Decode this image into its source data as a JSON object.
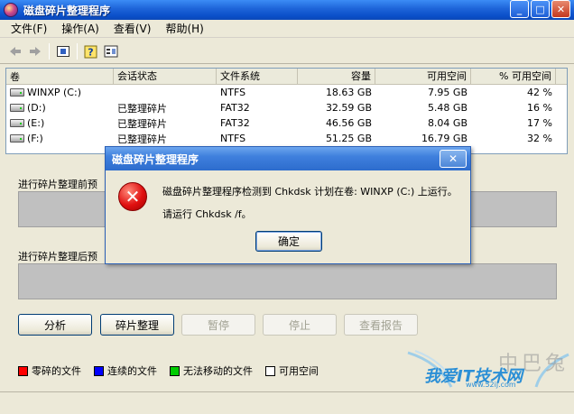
{
  "window": {
    "title": "磁盘碎片整理程序",
    "minimize_glyph": "_",
    "maximize_glyph": "□",
    "close_glyph": "✕"
  },
  "menu": [
    "文件(F)",
    "操作(A)",
    "查看(V)",
    "帮助(H)"
  ],
  "toolbar": {
    "back_icon": "left-arrow-icon",
    "forward_icon": "right-arrow-icon",
    "properties_icon": "properties-icon",
    "help_icon": "help-icon",
    "console_icon": "console-tree-icon"
  },
  "volumes": {
    "columns": [
      "卷",
      "会话状态",
      "文件系统",
      "容量",
      "可用空间",
      "% 可用空间"
    ],
    "rows": [
      {
        "volume": "WINXP (C:)",
        "status": "",
        "fs": "NTFS",
        "capacity": "18.63 GB",
        "free": "7.95 GB",
        "pct": "42 %"
      },
      {
        "volume": "(D:)",
        "status": "已整理碎片",
        "fs": "FAT32",
        "capacity": "32.59 GB",
        "free": "5.48 GB",
        "pct": "16 %"
      },
      {
        "volume": "(E:)",
        "status": "已整理碎片",
        "fs": "FAT32",
        "capacity": "46.56 GB",
        "free": "8.04 GB",
        "pct": "17 %"
      },
      {
        "volume": "(F:)",
        "status": "已整理碎片",
        "fs": "NTFS",
        "capacity": "51.25 GB",
        "free": "16.79 GB",
        "pct": "32 %"
      }
    ]
  },
  "panels": {
    "before_label": "进行碎片整理前预",
    "after_label": "进行碎片整理后预"
  },
  "buttons": {
    "analyze": "分析",
    "defragment": "碎片整理",
    "pause": "暂停",
    "stop": "停止",
    "view_report": "查看报告"
  },
  "legend": [
    {
      "label": "零碎的文件",
      "color": "#ff0000"
    },
    {
      "label": "连续的文件",
      "color": "#0000ff"
    },
    {
      "label": "无法移动的文件",
      "color": "#00cc00"
    },
    {
      "label": "可用空间",
      "color": "#ffffff"
    }
  ],
  "dialog": {
    "title": "磁盘碎片整理程序",
    "message_line1": "磁盘碎片整理程序检测到 Chkdsk 计划在卷: WINXP (C:) 上运行。",
    "message_line2": "请运行 Chkdsk /f。",
    "ok": "确定",
    "close_glyph": "✕",
    "icon": "error-icon",
    "icon_glyph": "✕"
  },
  "watermark": {
    "chars": "中巴兔",
    "main": "我爱IT技术网",
    "url": "www.52ij.com"
  }
}
